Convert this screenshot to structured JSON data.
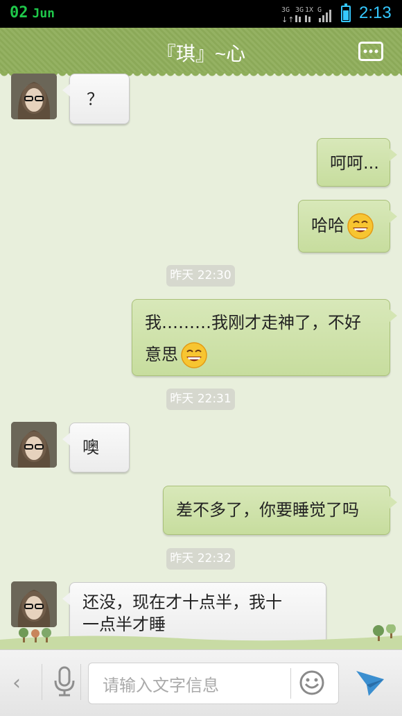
{
  "status_bar": {
    "day": "02",
    "month": "Jun",
    "network_types": [
      "3G",
      "3G",
      "1X",
      "G"
    ],
    "time": "2:13",
    "battery_level": 0.75
  },
  "header": {
    "title": "『琪』~心",
    "menu_icon": "more-dots-icon",
    "color": "#8fae5b"
  },
  "messages": [
    {
      "type": "message",
      "direction": "in",
      "text": "？"
    },
    {
      "type": "message",
      "direction": "out",
      "text": "呵呵..."
    },
    {
      "type": "message",
      "direction": "out",
      "text": "哈哈",
      "emoji": "grinning-face-icon"
    },
    {
      "type": "timestamp",
      "text": "昨天 22:30"
    },
    {
      "type": "message",
      "direction": "out",
      "line1": "我………我刚才走神了，不好",
      "line2": "意思",
      "emoji": "grinning-face-icon"
    },
    {
      "type": "timestamp",
      "text": "昨天 22:31"
    },
    {
      "type": "message",
      "direction": "in",
      "text": "噢"
    },
    {
      "type": "message",
      "direction": "out",
      "text": "差不多了，你要睡觉了吗"
    },
    {
      "type": "timestamp",
      "text": "昨天 22:32"
    },
    {
      "type": "message",
      "direction": "in",
      "line1": "还没，现在才十点半，我十",
      "line2": "一点半才睡"
    }
  ],
  "input_bar": {
    "placeholder": "请输入文字信息",
    "back_icon": "chevron-left-icon",
    "voice_icon": "microphone-icon",
    "emoji_icon": "smiley-icon",
    "send_icon": "send-icon",
    "send_color": "#3b8fd0"
  }
}
